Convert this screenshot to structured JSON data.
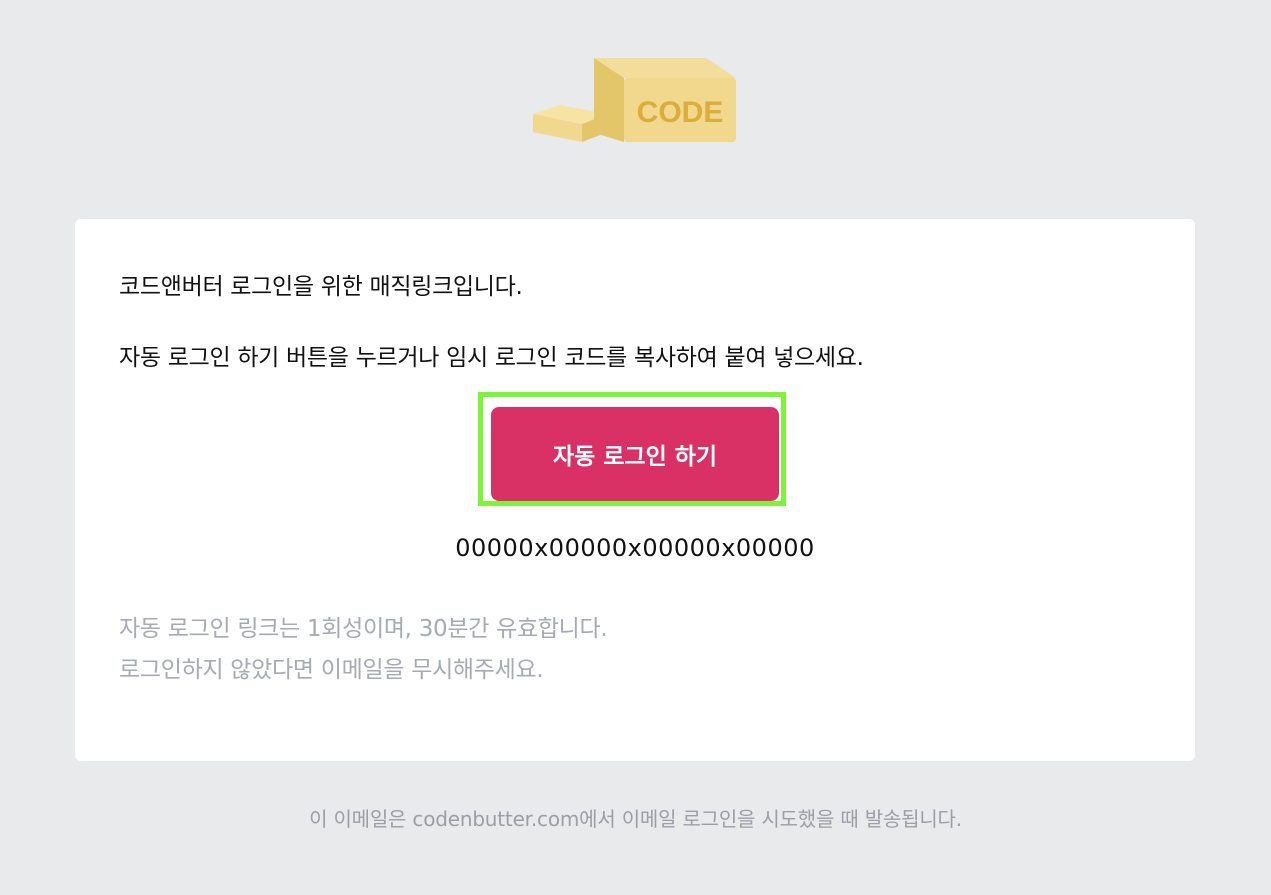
{
  "logo": {
    "text": "CODE",
    "icon": "butter-block-logo"
  },
  "card": {
    "intro": "코드앤버터 로그인을 위한 매직링크입니다.",
    "instruction": "자동 로그인 하기 버튼을 누르거나 임시 로그인 코드를 복사하여 붙여 넣으세요.",
    "login_button_label": "자동 로그인 하기",
    "login_code": "00000x00000x00000x00000",
    "note_line1": "자동 로그인 링크는 1회성이며, 30분간 유효합니다.",
    "note_line2": "로그인하지 않았다면 이메일을 무시해주세요."
  },
  "footer": {
    "text": "이 이메일은 codenbutter.com에서 이메일 로그인을 시도했을 때 발송됩니다."
  },
  "colors": {
    "background": "#e9eaec",
    "card": "#ffffff",
    "button": "#d93166",
    "highlight": "#7cf43a",
    "muted": "#a5aab3",
    "butter": "#f1d88c"
  }
}
